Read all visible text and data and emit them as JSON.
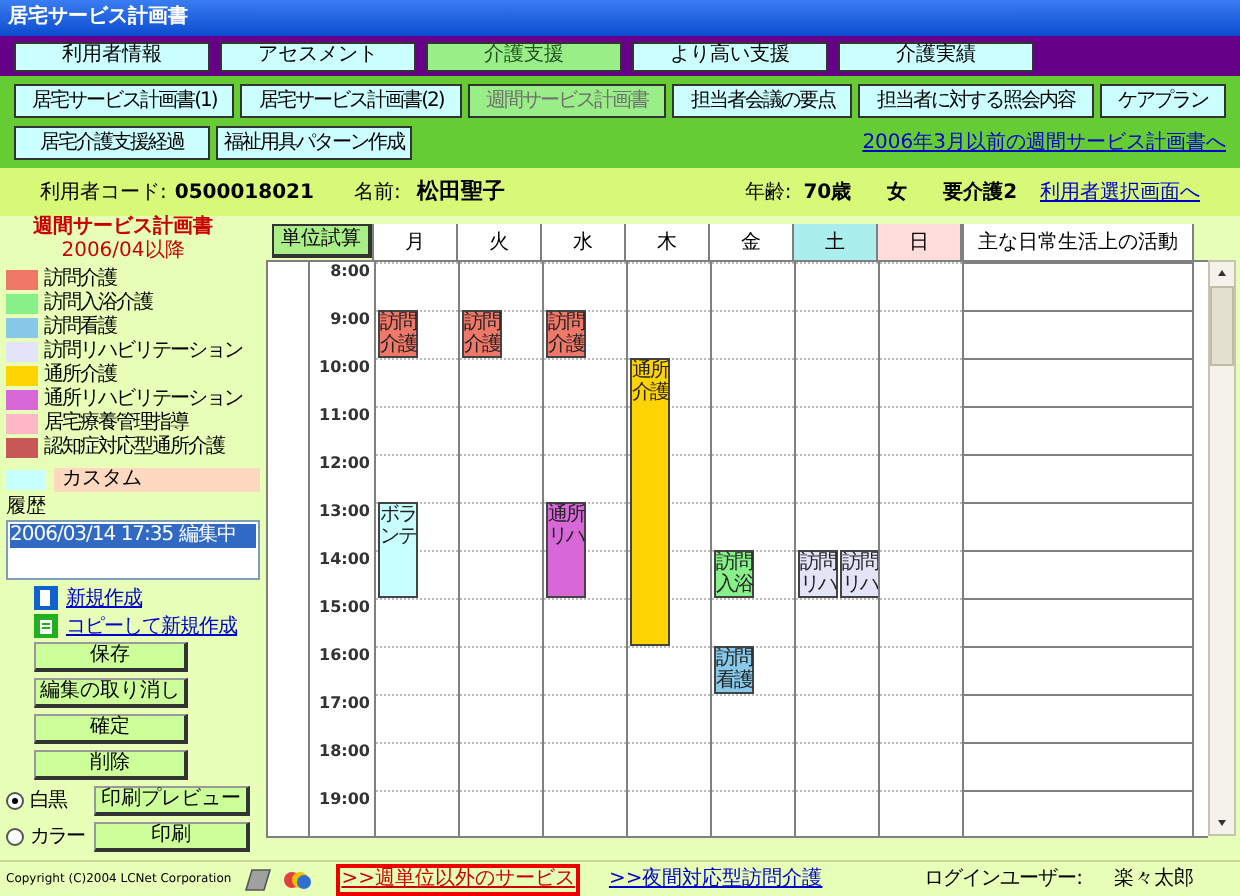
{
  "window": {
    "title": "居宅サービス計画書"
  },
  "main_tabs": [
    {
      "label": "利用者情報",
      "selected": false
    },
    {
      "label": "アセスメント",
      "selected": false
    },
    {
      "label": "介護支援",
      "selected": true
    },
    {
      "label": "より高い支援",
      "selected": false
    },
    {
      "label": "介護実績",
      "selected": false
    }
  ],
  "sub_tabs": [
    {
      "label": "居宅サービス計画書(1)",
      "selected": false
    },
    {
      "label": "居宅サービス計画書(2)",
      "selected": false
    },
    {
      "label": "週間サービス計画書",
      "selected": true
    },
    {
      "label": "担当者会議の要点",
      "selected": false
    },
    {
      "label": "担当者に対する照会内容",
      "selected": false
    },
    {
      "label": "ケアプラン",
      "selected": false
    },
    {
      "label": "居宅介護支援経過",
      "selected": false
    },
    {
      "label": "福祉用具パターン作成",
      "selected": false
    }
  ],
  "old_plan_link": "2006年3月以前の週間サービス計画書へ",
  "user": {
    "code_label": "利用者コード:",
    "code": "0500018021",
    "name_label": "名前:",
    "name": "松田聖子",
    "age_label": "年齢:",
    "age": "70歳",
    "sex": "女",
    "care_level": "要介護2",
    "select_link": "利用者選択画面へ"
  },
  "plan": {
    "title": "週間サービス計画書",
    "period": "2006/04以降"
  },
  "legend": [
    {
      "label": "訪問介護",
      "color": "#f07868"
    },
    {
      "label": "訪問入浴介護",
      "color": "#88f088"
    },
    {
      "label": "訪問看護",
      "color": "#88c8e8"
    },
    {
      "label": "訪問リハビリテーション",
      "color": "#e4e4f8"
    },
    {
      "label": "通所介護",
      "color": "#ffd400"
    },
    {
      "label": "通所リハビリテーション",
      "color": "#d868d8"
    },
    {
      "label": "居宅療養管理指導",
      "color": "#ffb8c8"
    },
    {
      "label": "認知症対応型通所介護",
      "color": "#c85858"
    }
  ],
  "custom": {
    "label": "カスタム",
    "color": "#c8ffff"
  },
  "history": {
    "label": "履歴",
    "items": [
      {
        "text": "2006/03/14 17:35 編集中",
        "selected": true
      }
    ]
  },
  "links": [
    {
      "label": "新規作成",
      "kind": "new"
    },
    {
      "label": "コピーして新規作成",
      "kind": "copy"
    }
  ],
  "actions": [
    "保存",
    "編集の取り消し",
    "確定",
    "削除"
  ],
  "print": {
    "options": [
      {
        "label": "白黒",
        "selected": true
      },
      {
        "label": "カラー",
        "selected": false
      }
    ],
    "buttons": [
      "印刷プレビュー",
      "印刷"
    ]
  },
  "schedule": {
    "calc_button": "単位試算",
    "activity_header": "主な日常生活上の活動",
    "hours": [
      "8:00",
      "9:00",
      "10:00",
      "11:00",
      "12:00",
      "13:00",
      "14:00",
      "15:00",
      "16:00",
      "17:00",
      "18:00",
      "19:00"
    ],
    "days": [
      {
        "label": "月",
        "kind": "weekday",
        "slots": [
          {
            "kind": "empty"
          },
          {
            "kind": "start",
            "blocks": [
              {
                "label": "訪問介護",
                "color": "#f07868"
              }
            ]
          },
          {
            "kind": "empty"
          },
          {
            "kind": "empty"
          },
          {
            "kind": "empty"
          },
          {
            "kind": "start",
            "blocks": [
              {
                "label": "ボランテ",
                "color": "#c8ffff"
              }
            ]
          },
          {
            "kind": "continue"
          },
          {
            "kind": "empty"
          },
          {
            "kind": "empty"
          },
          {
            "kind": "empty"
          },
          {
            "kind": "empty"
          },
          {
            "kind": "empty"
          }
        ]
      },
      {
        "label": "火",
        "kind": "weekday",
        "slots": [
          {
            "kind": "empty"
          },
          {
            "kind": "start",
            "blocks": [
              {
                "label": "訪問介護",
                "color": "#f07868"
              }
            ]
          },
          {
            "kind": "empty"
          },
          {
            "kind": "empty"
          },
          {
            "kind": "empty"
          },
          {
            "kind": "empty"
          },
          {
            "kind": "empty"
          },
          {
            "kind": "empty"
          },
          {
            "kind": "empty"
          },
          {
            "kind": "empty"
          },
          {
            "kind": "empty"
          },
          {
            "kind": "empty"
          }
        ]
      },
      {
        "label": "水",
        "kind": "weekday",
        "slots": [
          {
            "kind": "empty"
          },
          {
            "kind": "start",
            "blocks": [
              {
                "label": "訪問介護",
                "color": "#f07868"
              }
            ]
          },
          {
            "kind": "empty"
          },
          {
            "kind": "empty"
          },
          {
            "kind": "empty"
          },
          {
            "kind": "start",
            "blocks": [
              {
                "label": "通所リハ",
                "color": "#d868d8"
              }
            ]
          },
          {
            "kind": "continue"
          },
          {
            "kind": "empty"
          },
          {
            "kind": "empty"
          },
          {
            "kind": "empty"
          },
          {
            "kind": "empty"
          },
          {
            "kind": "empty"
          }
        ]
      },
      {
        "label": "木",
        "kind": "weekday",
        "slots": [
          {
            "kind": "empty"
          },
          {
            "kind": "empty"
          },
          {
            "kind": "start",
            "blocks": [
              {
                "label": "通所介護",
                "color": "#ffd400"
              }
            ]
          },
          {
            "kind": "continue"
          },
          {
            "kind": "continue"
          },
          {
            "kind": "continue"
          },
          {
            "kind": "continue"
          },
          {
            "kind": "continue"
          },
          {
            "kind": "empty"
          },
          {
            "kind": "empty"
          },
          {
            "kind": "empty"
          },
          {
            "kind": "empty"
          }
        ]
      },
      {
        "label": "金",
        "kind": "weekday",
        "slots": [
          {
            "kind": "empty"
          },
          {
            "kind": "empty"
          },
          {
            "kind": "empty"
          },
          {
            "kind": "empty"
          },
          {
            "kind": "empty"
          },
          {
            "kind": "empty"
          },
          {
            "kind": "start",
            "blocks": [
              {
                "label": "訪問入浴",
                "color": "#88f088"
              }
            ]
          },
          {
            "kind": "empty"
          },
          {
            "kind": "start",
            "blocks": [
              {
                "label": "訪問看護",
                "color": "#88c8e8"
              }
            ]
          },
          {
            "kind": "empty"
          },
          {
            "kind": "empty"
          },
          {
            "kind": "empty"
          }
        ]
      },
      {
        "label": "土",
        "kind": "saturday",
        "slots": [
          {
            "kind": "empty"
          },
          {
            "kind": "empty"
          },
          {
            "kind": "empty"
          },
          {
            "kind": "empty"
          },
          {
            "kind": "empty"
          },
          {
            "kind": "empty"
          },
          {
            "kind": "start",
            "blocks": [
              {
                "label": "訪問リハ",
                "color": "#e4e4f8"
              },
              {
                "label": "訪問リハ",
                "color": "#e4e4f8"
              }
            ]
          },
          {
            "kind": "empty"
          },
          {
            "kind": "empty"
          },
          {
            "kind": "empty"
          },
          {
            "kind": "empty"
          },
          {
            "kind": "empty"
          }
        ]
      },
      {
        "label": "日",
        "kind": "sunday",
        "slots": [
          {
            "kind": "empty"
          },
          {
            "kind": "empty"
          },
          {
            "kind": "empty"
          },
          {
            "kind": "empty"
          },
          {
            "kind": "empty"
          },
          {
            "kind": "empty"
          },
          {
            "kind": "empty"
          },
          {
            "kind": "empty"
          },
          {
            "kind": "empty"
          },
          {
            "kind": "empty"
          },
          {
            "kind": "empty"
          },
          {
            "kind": "empty"
          }
        ]
      }
    ]
  },
  "footer": {
    "copyright": "Copyright (C)2004 LCNet Corporation",
    "links": [
      {
        "label": ">>週単位以外のサービス",
        "highlighted": true
      },
      {
        "label": ">>夜間対応型訪問介護",
        "highlighted": false
      }
    ],
    "login_label": "ログインユーザー:",
    "login_user": "楽々太郎"
  }
}
